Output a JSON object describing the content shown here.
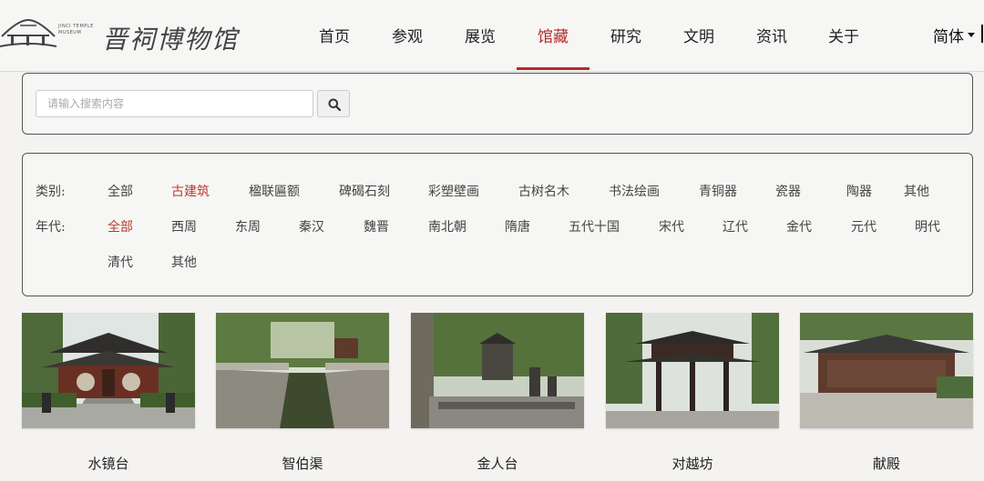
{
  "header": {
    "logo_text": "晋祠博物馆",
    "logo_en_1": "JINCI TEMPLE",
    "logo_en_2": "MUSEUM",
    "nav": [
      "首页",
      "参观",
      "展览",
      "馆藏",
      "研究",
      "文明",
      "资讯",
      "关于"
    ],
    "active_nav": "馆藏",
    "language": "简体"
  },
  "search": {
    "placeholder": "请输入搜索内容",
    "button_icon": "search-icon"
  },
  "filters": {
    "category_label": "类别:",
    "categories": [
      "全部",
      "古建筑",
      "楹联匾额",
      "碑碣石刻",
      "彩塑壁画",
      "古树名木",
      "书法绘画",
      "青铜器",
      "瓷器",
      "陶器",
      "其他"
    ],
    "category_active": "古建筑",
    "era_label": "年代:",
    "eras_row1": [
      "全部",
      "西周",
      "东周",
      "秦汉",
      "魏晋",
      "南北朝",
      "隋唐",
      "五代十国",
      "宋代",
      "辽代",
      "金代",
      "元代",
      "明代"
    ],
    "eras_row2": [
      "清代",
      "其他"
    ],
    "era_active": "全部"
  },
  "items": [
    {
      "title": "水镜台"
    },
    {
      "title": "智伯渠"
    },
    {
      "title": "金人台"
    },
    {
      "title": "对越坊"
    },
    {
      "title": "献殿"
    }
  ],
  "colors": {
    "accent": "#b52a2a",
    "active_filter": "#c0392b"
  }
}
